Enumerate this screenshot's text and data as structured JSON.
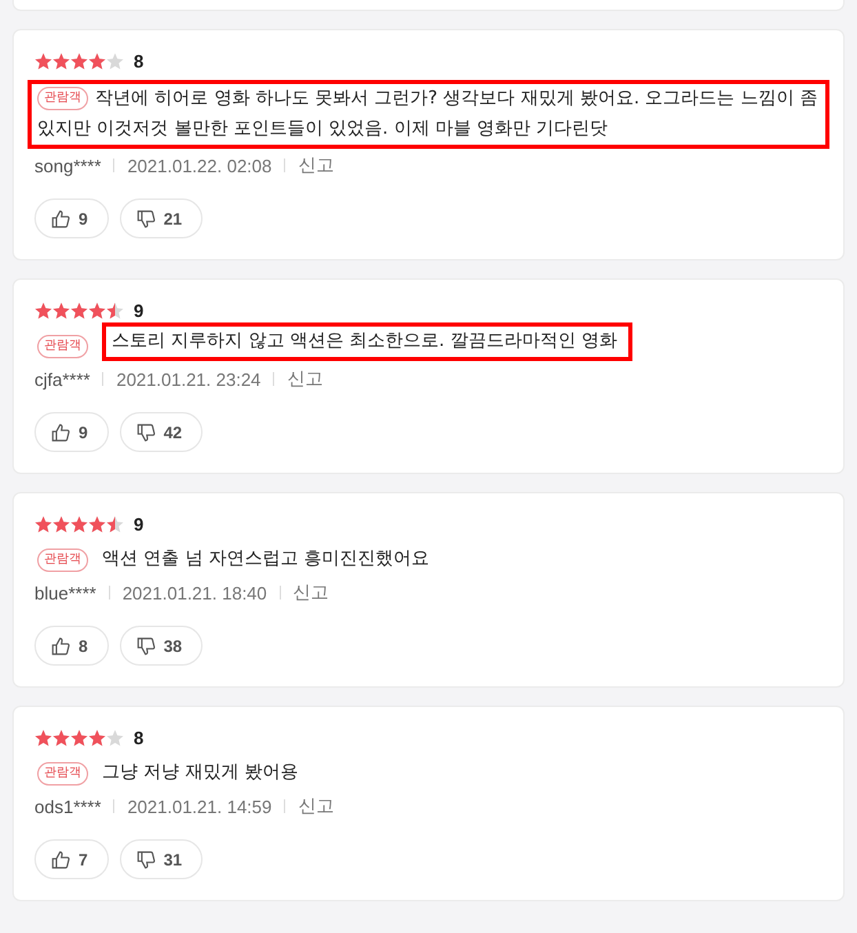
{
  "reviews": [
    {
      "stars": 4,
      "score": "8",
      "badge": "관람객",
      "text": "작년에 히어로 영화 하나도 못봐서 그런가? 생각보다 재밌게 봤어요. 오그라드는 느낌이 좀 있지만 이것저것 볼만한 포인트들이 있었음. 이제 마블 영화만 기다린닷",
      "kind": "block_highlight",
      "user": "song****",
      "date": "2021.01.22. 02:08",
      "report": "신고",
      "likes": "9",
      "dislikes": "21"
    },
    {
      "stars": 4.5,
      "score": "9",
      "badge": "관람객",
      "text": "스토리 지루하지 않고 액션은 최소한으로. 깔끔드라마적인 영화",
      "kind": "text_highlight",
      "user": "cjfa****",
      "date": "2021.01.21. 23:24",
      "report": "신고",
      "likes": "9",
      "dislikes": "42"
    },
    {
      "stars": 4.5,
      "score": "9",
      "badge": "관람객",
      "text": "액션 연출 넘 자연스럽고 흥미진진했어요",
      "kind": "plain",
      "user": "blue****",
      "date": "2021.01.21. 18:40",
      "report": "신고",
      "likes": "8",
      "dislikes": "38"
    },
    {
      "stars": 4,
      "score": "8",
      "badge": "관람객",
      "text": "그냥 저냥 재밌게 봤어용",
      "kind": "plain",
      "user": "ods1****",
      "date": "2021.01.21. 14:59",
      "report": "신고",
      "likes": "7",
      "dislikes": "31"
    }
  ]
}
